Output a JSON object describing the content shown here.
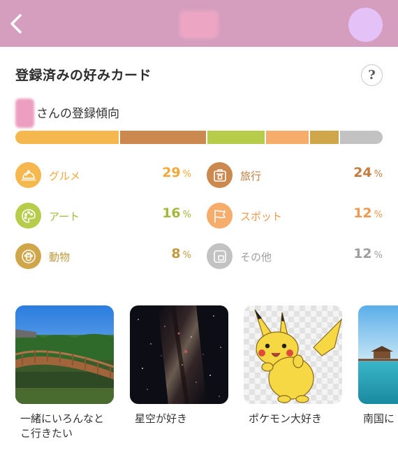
{
  "header": {
    "back_icon": "chevron-left-icon",
    "colors": {
      "bar": "#d59ebe",
      "avatar": "#e4c1f7"
    }
  },
  "section": {
    "title": "登録済みの好みカード",
    "help_label": "?",
    "subtitle": "さんの登録傾向"
  },
  "distribution": [
    {
      "name": "グルメ",
      "percent": 29,
      "color": "#f5b84f"
    },
    {
      "name": "旅行",
      "percent": 24,
      "color": "#cb8950"
    },
    {
      "name": "アート",
      "percent": 16,
      "color": "#b7cc4b"
    },
    {
      "name": "スポット",
      "percent": 12,
      "color": "#f6ac6b"
    },
    {
      "name": "動物",
      "percent": 8,
      "color": "#cfa64a"
    },
    {
      "name": "その他",
      "percent": 12,
      "color": "#c2c2c2"
    }
  ],
  "categories": [
    {
      "label": "グルメ",
      "percent": "29",
      "unit": "%",
      "icon": "food-cloche-icon",
      "color": "#f5b84f",
      "text_color": "#f0a93a"
    },
    {
      "label": "旅行",
      "percent": "24",
      "unit": "%",
      "icon": "suitcase-icon",
      "color": "#cb8950",
      "text_color": "#c47d3e"
    },
    {
      "label": "アート",
      "percent": "16",
      "unit": "%",
      "icon": "palette-icon",
      "color": "#b7cc4b",
      "text_color": "#a2b93b"
    },
    {
      "label": "スポット",
      "percent": "12",
      "unit": "%",
      "icon": "flag-icon",
      "color": "#f6ac6b",
      "text_color": "#ef9850"
    },
    {
      "label": "動物",
      "percent": "8",
      "unit": "%",
      "icon": "animal-paw-icon",
      "color": "#cfa64a",
      "text_color": "#c29a3e"
    },
    {
      "label": "その他",
      "percent": "12",
      "unit": "%",
      "icon": "other-card-icon",
      "color": "#c2c2c2",
      "text_color": "#9e9e9e"
    }
  ],
  "cards": [
    {
      "label": "一緒にいろんなと\nこ行きたい",
      "image": "wooden-bridge-park-image"
    },
    {
      "label": "星空が好き",
      "image": "milky-way-image"
    },
    {
      "label": "ポケモン大好き",
      "image": "pikachu-image"
    },
    {
      "label": "南国に",
      "image": "tropical-pier-image"
    }
  ]
}
